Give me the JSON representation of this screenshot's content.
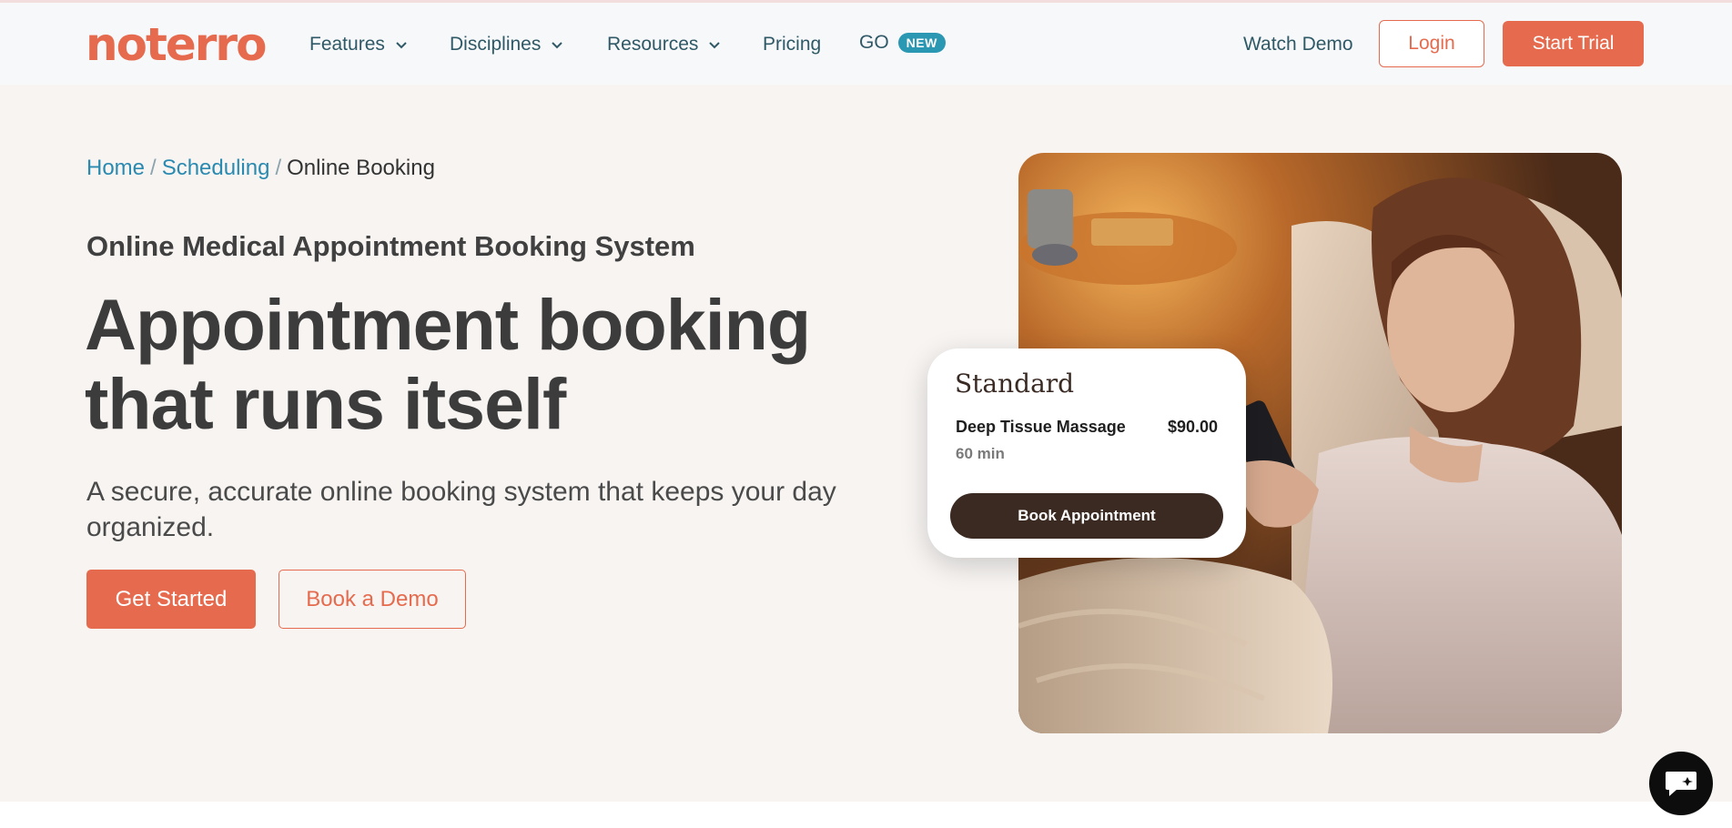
{
  "brand": {
    "logo_text": "noterro",
    "accent": "#e66b4e",
    "link_color": "#2a8ab0"
  },
  "nav": {
    "items": [
      {
        "label": "Features",
        "has_dropdown": true
      },
      {
        "label": "Disciplines",
        "has_dropdown": true
      },
      {
        "label": "Resources",
        "has_dropdown": true
      },
      {
        "label": "Pricing",
        "has_dropdown": false
      },
      {
        "label": "GO",
        "badge": "NEW"
      }
    ],
    "watch_demo": "Watch Demo",
    "login": "Login",
    "start_trial": "Start Trial"
  },
  "breadcrumb": {
    "home": "Home",
    "scheduling": "Scheduling",
    "current": "Online Booking",
    "separator": "/"
  },
  "hero": {
    "eyebrow": "Online Medical Appointment Booking System",
    "headline_line1": "Appointment booking",
    "headline_line2": "that runs itself",
    "subtext": "A secure, accurate online booking system that keeps your day organized.",
    "cta_primary": "Get Started",
    "cta_secondary": "Book a Demo"
  },
  "booking_card": {
    "title": "Standard",
    "service": "Deep Tissue Massage",
    "price": "$90.00",
    "duration": "60 min",
    "button": "Book Appointment"
  },
  "icons": {
    "dropdown": "chevron-down-icon",
    "chat": "chat-icon"
  }
}
